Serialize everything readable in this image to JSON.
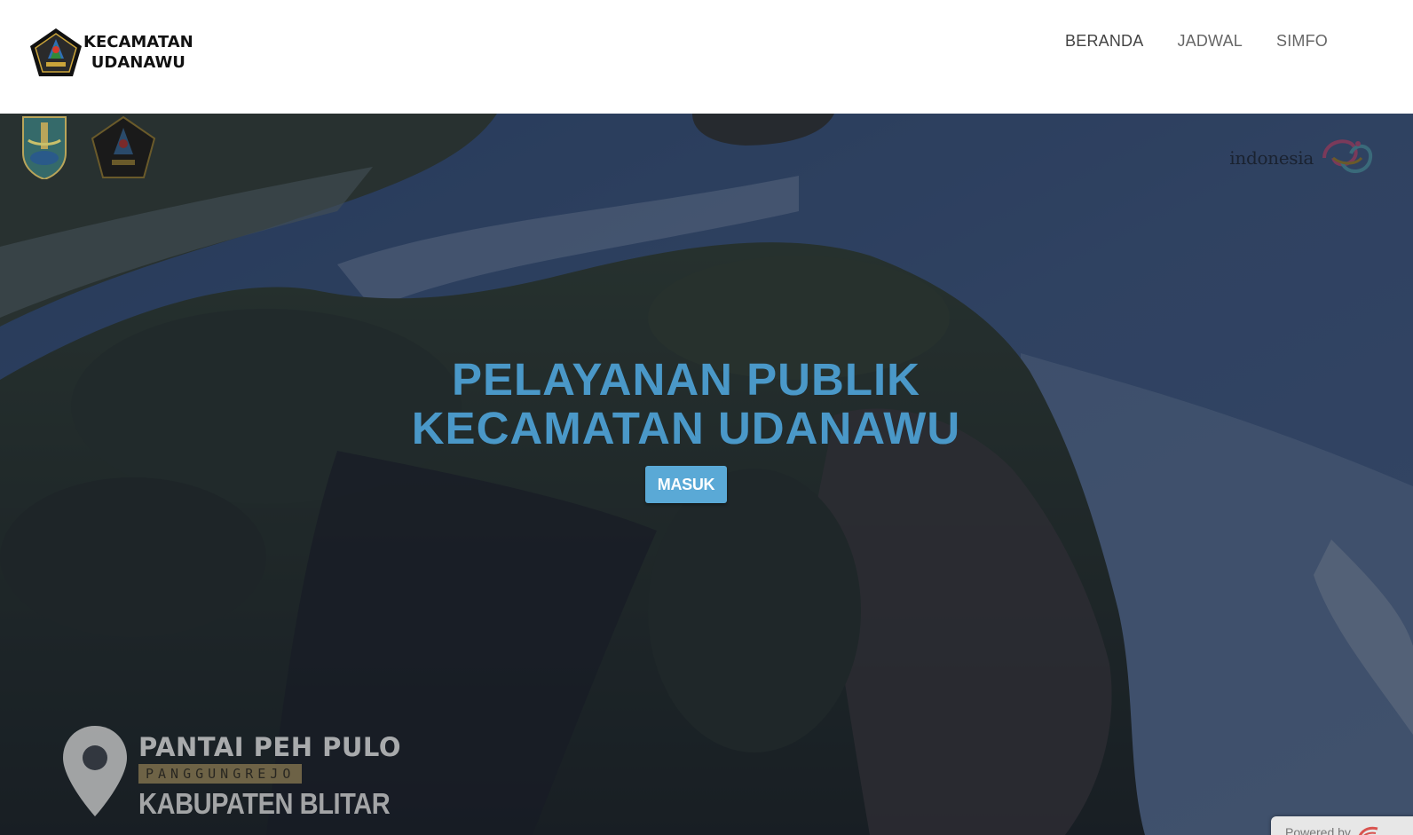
{
  "header": {
    "brand_line1": "KECAMATAN",
    "brand_line2": "UDANAWU",
    "nav": [
      {
        "label": "BERANDA",
        "active": true
      },
      {
        "label": "JADWAL",
        "active": false
      },
      {
        "label": "SIMFO",
        "active": false
      }
    ]
  },
  "hero": {
    "title_line1": "PELAYANAN PUBLIK",
    "title_line2": "KECAMATAN UDANAWU",
    "button_label": "MASUK",
    "partner_text": "indonesia",
    "location": {
      "title": "PANTAI PEH PULO",
      "village": "PANGGUNGREJO",
      "regency": "KABUPATEN BLITAR"
    }
  },
  "footer_badge": {
    "text": "Powered by"
  },
  "colors": {
    "accent": "#4a98c8",
    "button": "#5aa9d6",
    "nav_text": "#666666"
  },
  "icons": [
    "blitar-emblem-icon",
    "jatim-emblem-icon",
    "wonderful-indonesia-logo",
    "location-pin-icon"
  ]
}
